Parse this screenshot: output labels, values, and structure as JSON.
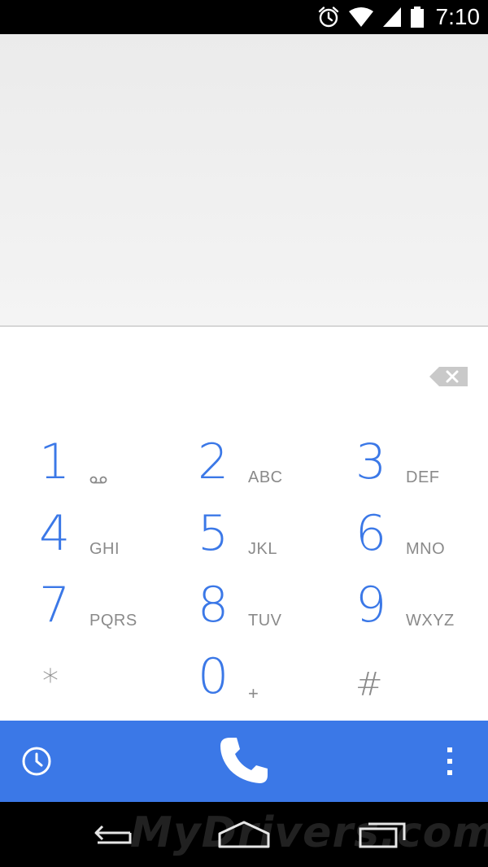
{
  "status_bar": {
    "time": "7:10",
    "icons": [
      "alarm-icon",
      "wifi-icon",
      "cell-signal-icon",
      "battery-icon"
    ]
  },
  "display": {
    "digits": ""
  },
  "keypad": {
    "keys": [
      {
        "digit": "1",
        "letters": "",
        "icon": "voicemail-icon"
      },
      {
        "digit": "2",
        "letters": "ABC"
      },
      {
        "digit": "3",
        "letters": "DEF"
      },
      {
        "digit": "4",
        "letters": "GHI"
      },
      {
        "digit": "5",
        "letters": "JKL"
      },
      {
        "digit": "6",
        "letters": "MNO"
      },
      {
        "digit": "7",
        "letters": "PQRS"
      },
      {
        "digit": "8",
        "letters": "TUV"
      },
      {
        "digit": "9",
        "letters": "WXYZ"
      },
      {
        "digit": "*",
        "letters": ""
      },
      {
        "digit": "0",
        "letters": "+"
      },
      {
        "digit": "#",
        "letters": ""
      }
    ],
    "backspace_icon": "backspace-icon"
  },
  "action_bar": {
    "left_icon": "history-icon",
    "center_icon": "phone-call-icon",
    "right_icon": "overflow-menu-icon"
  },
  "nav_bar": {
    "icons": [
      "back-icon",
      "home-icon",
      "recents-icon"
    ],
    "watermark": "MyDrivers.com"
  },
  "colors": {
    "accent": "#3b78e7",
    "status_bar": "#000000",
    "display_bg": "#efefef",
    "key_letters": "#8a8a8a"
  }
}
